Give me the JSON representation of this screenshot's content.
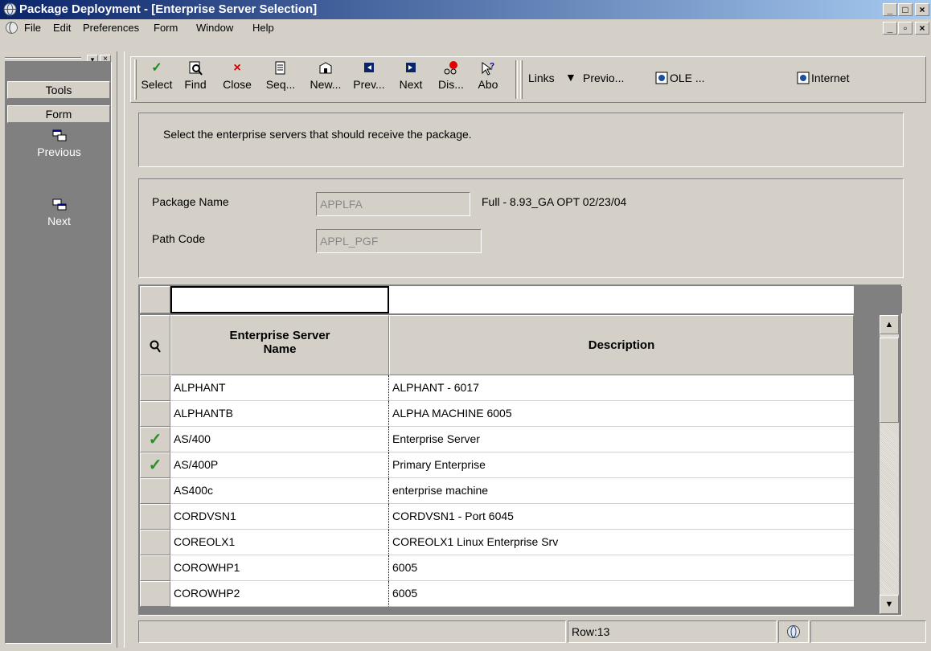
{
  "window": {
    "title": "Package Deployment - [Enterprise Server Selection]"
  },
  "menu": [
    "File",
    "Edit",
    "Preferences",
    "Form",
    "Window",
    "Help"
  ],
  "sidebar": {
    "tools_label": "Tools",
    "form_label": "Form",
    "previous_label": "Previous",
    "next_label": "Next"
  },
  "toolbar": {
    "buttons": [
      {
        "label": "Select",
        "icon": "checkmark-icon",
        "color": "#1a8c1a"
      },
      {
        "label": "Find",
        "icon": "find-icon"
      },
      {
        "label": "Close",
        "icon": "close-icon",
        "color": "#cc0000"
      },
      {
        "label": "Seq...",
        "icon": "sequence-icon"
      },
      {
        "label": "New...",
        "icon": "new-icon"
      },
      {
        "label": "Prev...",
        "icon": "prev-icon"
      },
      {
        "label": "Next",
        "icon": "next-icon"
      },
      {
        "label": "Dis...",
        "icon": "display-icon"
      },
      {
        "label": "Abo",
        "icon": "about-icon"
      }
    ],
    "links_label": "Links",
    "previo_label": "Previo...",
    "ole_label": "OLE ...",
    "internet_label": "Internet"
  },
  "instructions": "Select the enterprise servers that should receive the package.",
  "form": {
    "package_name_label": "Package Name",
    "package_name_value": "APPLFA",
    "package_desc": "Full - 8.93_GA OPT 02/23/04",
    "path_code_label": "Path Code",
    "path_code_value": "APPL_PGF"
  },
  "grid": {
    "col_server": "Enterprise Server Name",
    "col_desc": "Description",
    "rows": [
      {
        "server": "ALPHANT",
        "desc": "ALPHANT - 6017",
        "checked": false
      },
      {
        "server": "ALPHANTB",
        "desc": "ALPHA MACHINE 6005",
        "checked": false
      },
      {
        "server": "AS/400",
        "desc": "Enterprise Server",
        "checked": true
      },
      {
        "server": "AS/400P",
        "desc": "Primary Enterprise",
        "checked": true
      },
      {
        "server": "AS400c",
        "desc": "enterprise machine",
        "checked": false
      },
      {
        "server": "CORDVSN1",
        "desc": "CORDVSN1 - Port 6045",
        "checked": false
      },
      {
        "server": "COREOLX1",
        "desc": "COREOLX1 Linux Enterprise Srv",
        "checked": false
      },
      {
        "server": "COROWHP1",
        "desc": "6005",
        "checked": false
      },
      {
        "server": "COROWHP2",
        "desc": "6005",
        "checked": false
      }
    ]
  },
  "status": {
    "row_text": "Row:13"
  },
  "colors": {
    "titlebar_start": "#0a246a",
    "titlebar_end": "#a6caf0",
    "face": "#d4d0c8",
    "check_green": "#2e8b2e"
  }
}
